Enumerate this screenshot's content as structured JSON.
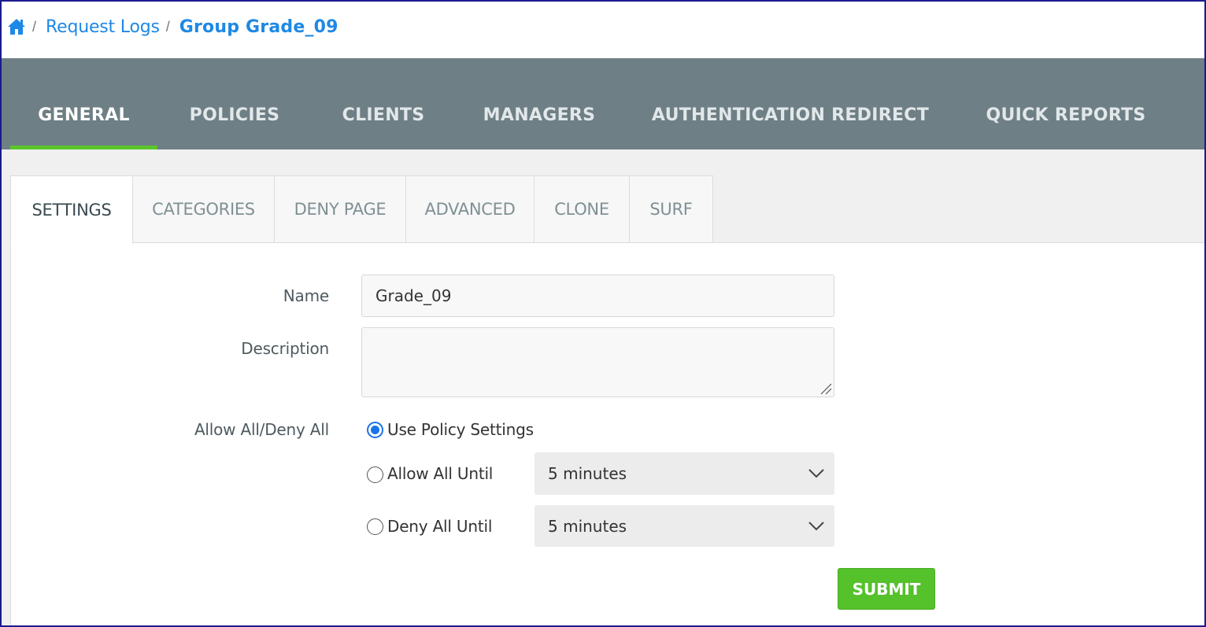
{
  "breadcrumb": {
    "home_icon": "home-icon",
    "separator": "/",
    "link": "Request Logs",
    "current": "Group Grade_09"
  },
  "main_tabs": [
    {
      "label": "GENERAL",
      "active": true
    },
    {
      "label": "POLICIES",
      "active": false
    },
    {
      "label": "CLIENTS",
      "active": false
    },
    {
      "label": "MANAGERS",
      "active": false
    },
    {
      "label": "AUTHENTICATION REDIRECT",
      "active": false
    },
    {
      "label": "QUICK REPORTS",
      "active": false
    }
  ],
  "sub_tabs": [
    {
      "label": "SETTINGS",
      "active": true
    },
    {
      "label": "CATEGORIES",
      "active": false
    },
    {
      "label": "DENY PAGE",
      "active": false
    },
    {
      "label": "ADVANCED",
      "active": false
    },
    {
      "label": "CLONE",
      "active": false
    },
    {
      "label": "SURF",
      "active": false
    }
  ],
  "form": {
    "name_label": "Name",
    "name_value": "Grade_09",
    "description_label": "Description",
    "description_value": "",
    "allow_deny_label": "Allow All/Deny All",
    "options": [
      {
        "label": "Use Policy Settings",
        "checked": true
      },
      {
        "label": "Allow All Until",
        "checked": false,
        "select_value": "5 minutes"
      },
      {
        "label": "Deny All Until",
        "checked": false,
        "select_value": "5 minutes"
      }
    ],
    "submit_label": "SUBMIT"
  },
  "colors": {
    "accent_blue": "#1e88e5",
    "tab_bar_bg": "#6e7f85",
    "active_tab_indicator": "#5cc52a",
    "submit_bg": "#55c12b",
    "radio_checked": "#1a73e8"
  }
}
